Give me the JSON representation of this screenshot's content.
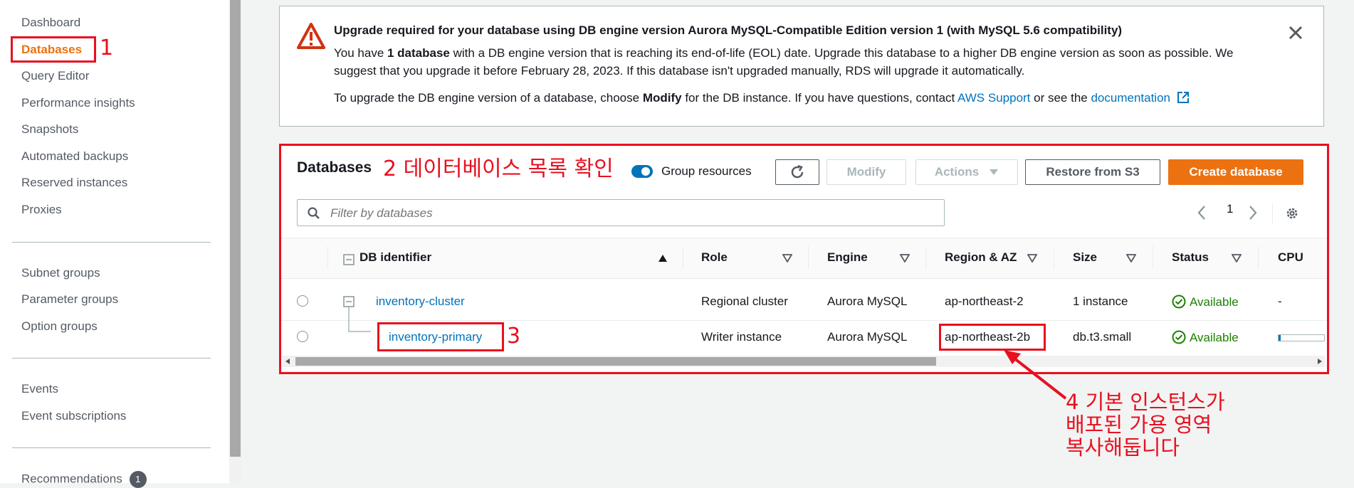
{
  "sidebar": {
    "items": [
      {
        "label": "Dashboard"
      },
      {
        "label": "Databases"
      },
      {
        "label": "Query Editor"
      },
      {
        "label": "Performance insights"
      },
      {
        "label": "Snapshots"
      },
      {
        "label": "Automated backups"
      },
      {
        "label": "Reserved instances"
      },
      {
        "label": "Proxies"
      },
      {
        "label": "Subnet groups"
      },
      {
        "label": "Parameter groups"
      },
      {
        "label": "Option groups"
      },
      {
        "label": "Events"
      },
      {
        "label": "Event subscriptions"
      },
      {
        "label": "Recommendations",
        "badge": "1"
      }
    ]
  },
  "alert": {
    "title": "Upgrade required for your database using DB engine version Aurora MySQL-Compatible Edition version 1 (with MySQL 5.6 compatibility)",
    "line1_pre": "You have ",
    "line1_bold": "1 database",
    "line1_post": " with a DB engine version that is reaching its end-of-life (EOL) date. Upgrade this database to a higher DB engine version as soon as possible. We",
    "line2": "suggest that you upgrade it before February 28, 2023. If this database isn't upgraded manually, RDS will upgrade it automatically.",
    "line3_pre": "To upgrade the DB engine version of a database, choose ",
    "line3_bold": "Modify",
    "line3_mid": " for the DB instance. If you have questions, contact ",
    "line3_link1": "AWS Support",
    "line3_or": " or see the ",
    "line3_link2": "documentation"
  },
  "databases": {
    "title": "Databases",
    "group_resources": "Group resources",
    "buttons": {
      "modify": "Modify",
      "actions": "Actions",
      "restore": "Restore from S3",
      "create": "Create database"
    },
    "filter_placeholder": "Filter by databases",
    "page": "1",
    "columns": [
      "DB identifier",
      "Role",
      "Engine",
      "Region & AZ",
      "Size",
      "Status",
      "CPU"
    ],
    "rows": [
      {
        "id": "inventory-cluster",
        "role": "Regional cluster",
        "engine": "Aurora MySQL",
        "region": "ap-northeast-2",
        "size": "1 instance",
        "status": "Available",
        "cpu": "-"
      },
      {
        "id": "inventory-primary",
        "role": "Writer instance",
        "engine": "Aurora MySQL",
        "region": "ap-northeast-2b",
        "size": "db.t3.small",
        "status": "Available",
        "cpu": ""
      }
    ]
  },
  "annotations": {
    "n1": "1",
    "n2": "2 데이터베이스 목록 확인",
    "n3": "3",
    "n4_line1": "4 기본 인스턴스가",
    "n4_line2": "배포된 가용 영역",
    "n4_line3": "복사해둡니다",
    "color": "#e8101f"
  }
}
